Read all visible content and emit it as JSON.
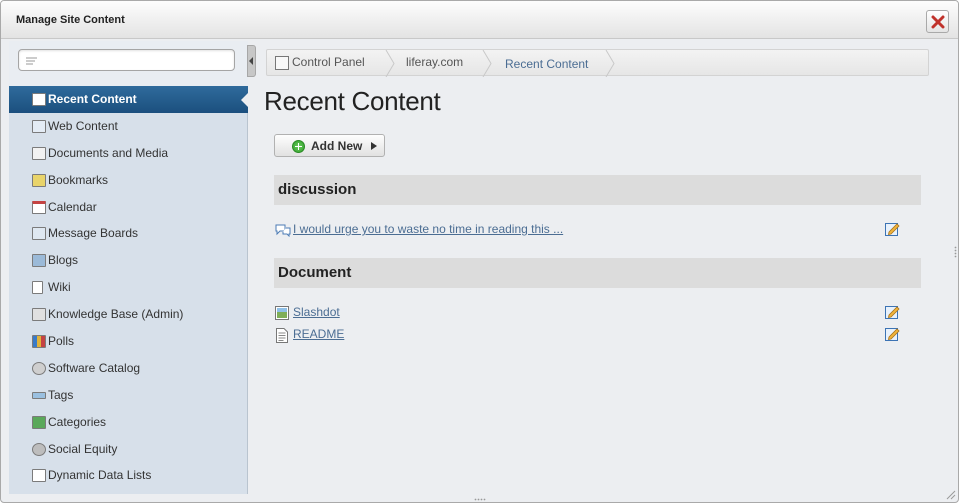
{
  "dialog": {
    "title": "Manage Site Content"
  },
  "sidebar": {
    "search": {
      "placeholder": "",
      "value": ""
    },
    "items": [
      {
        "label": "Recent Content",
        "icon": "recent-content-icon",
        "active": true
      },
      {
        "label": "Web Content",
        "icon": "web-content-icon"
      },
      {
        "label": "Documents and Media",
        "icon": "documents-media-icon"
      },
      {
        "label": "Bookmarks",
        "icon": "bookmarks-icon"
      },
      {
        "label": "Calendar",
        "icon": "calendar-icon"
      },
      {
        "label": "Message Boards",
        "icon": "message-boards-icon"
      },
      {
        "label": "Blogs",
        "icon": "blogs-icon"
      },
      {
        "label": "Wiki",
        "icon": "wiki-icon"
      },
      {
        "label": "Knowledge Base (Admin)",
        "icon": "knowledge-base-icon"
      },
      {
        "label": "Polls",
        "icon": "polls-icon"
      },
      {
        "label": "Software Catalog",
        "icon": "software-catalog-icon"
      },
      {
        "label": "Tags",
        "icon": "tags-icon"
      },
      {
        "label": "Categories",
        "icon": "categories-icon"
      },
      {
        "label": "Social Equity",
        "icon": "social-equity-icon"
      },
      {
        "label": "Dynamic Data Lists",
        "icon": "dynamic-data-lists-icon"
      }
    ]
  },
  "breadcrumb": {
    "items": [
      "Control Panel",
      "liferay.com",
      "Recent Content"
    ]
  },
  "main": {
    "title": "Recent Content",
    "add_new_label": "Add New",
    "sections": [
      {
        "header": "discussion",
        "entries": [
          {
            "title": "I would urge you to waste no time in reading this ...",
            "icon": "discussion-icon"
          }
        ]
      },
      {
        "header": "Document",
        "entries": [
          {
            "title": "Slashdot",
            "icon": "image-file-icon"
          },
          {
            "title": "README",
            "icon": "text-file-icon"
          }
        ]
      }
    ]
  },
  "colors": {
    "active_nav": "#1f5a8a",
    "link": "#4b6d93",
    "close_red": "#c0322b",
    "sidebar_bg": "#d7e0ea"
  }
}
